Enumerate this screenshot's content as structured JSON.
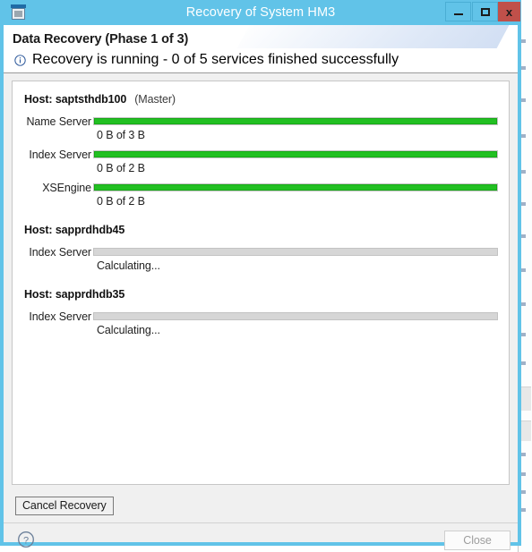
{
  "window": {
    "title": "Recovery of System HM3",
    "icon": "application-icon",
    "controls": {
      "minimize": "minimize-icon",
      "maximize": "maximize-icon",
      "close": "x"
    }
  },
  "header": {
    "title": "Data Recovery (Phase 1 of 3)",
    "status_icon": "info-icon",
    "status_text": "Recovery is running - 0 of 5 services finished successfully"
  },
  "hosts": [
    {
      "label": "Host:",
      "name": "saptsthdb100",
      "role": "(Master)",
      "services": [
        {
          "name": "Name Server",
          "status": "0 B of 3 B",
          "percent": 100
        },
        {
          "name": "Index Server",
          "status": "0 B of 2 B",
          "percent": 100
        },
        {
          "name": "XSEngine",
          "status": "0 B of 2 B",
          "percent": 100
        }
      ]
    },
    {
      "label": "Host:",
      "name": "sapprdhdb45",
      "role": "",
      "services": [
        {
          "name": "Index Server",
          "status": "Calculating...",
          "percent": 0
        }
      ]
    },
    {
      "label": "Host:",
      "name": "sapprdhdb35",
      "role": "",
      "services": [
        {
          "name": "Index Server",
          "status": "Calculating...",
          "percent": 0
        }
      ]
    }
  ],
  "actions": {
    "cancel_recovery": "Cancel Recovery",
    "help": "?",
    "close": "Close"
  },
  "colors": {
    "frame": "#61c3e8",
    "close_button": "#c0504a",
    "progress_fill": "#22c022",
    "progress_track": "#d6d6d6"
  }
}
